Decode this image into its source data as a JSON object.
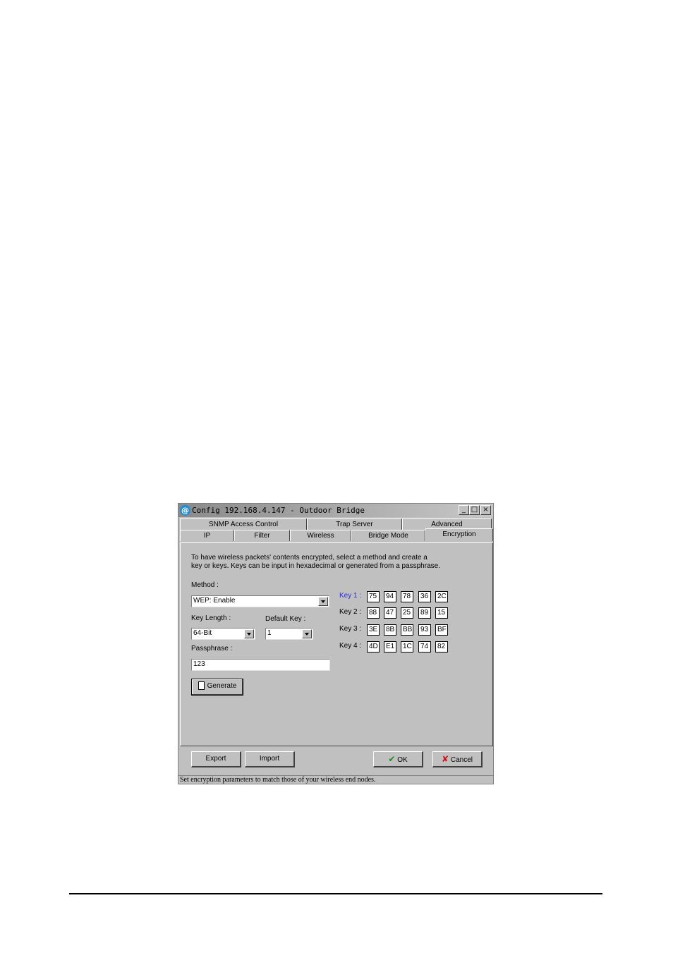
{
  "window": {
    "title": "Config 192.168.4.147 - Outdoor Bridge",
    "controls": [
      "_",
      "□",
      "×"
    ]
  },
  "tabs_row1": [
    "SNMP Access Control",
    "Trap Server",
    "Advanced"
  ],
  "tabs_row2": [
    "IP",
    "Filter",
    "Wireless",
    "Bridge Mode",
    "Encryption"
  ],
  "active_tab": "Encryption",
  "description": {
    "line1": "To have wireless packets' contents encrypted, select a method and create a",
    "line2": "key or keys. Keys can be input in hexadecimal or generated from a passphrase."
  },
  "method": {
    "label": "Method :",
    "value": "WEP: Enable"
  },
  "key_length": {
    "label": "Key Length :",
    "value": "64-Bit"
  },
  "default_key": {
    "label": "Default Key :",
    "value": "1"
  },
  "passphrase": {
    "label": "Passphrase :",
    "value": "123"
  },
  "generate_label": "Generate",
  "keys": [
    {
      "label": "Key 1 :",
      "values": [
        "75",
        "94",
        "78",
        "36",
        "2C"
      ]
    },
    {
      "label": "Key 2 :",
      "values": [
        "88",
        "47",
        "25",
        "89",
        "15"
      ]
    },
    {
      "label": "Key 3 :",
      "values": [
        "3E",
        "8B",
        "BB",
        "93",
        "BF"
      ]
    },
    {
      "label": "Key 4 :",
      "values": [
        "4D",
        "E1",
        "1C",
        "74",
        "82"
      ]
    }
  ],
  "buttons": {
    "export": "Export",
    "import": "Import",
    "ok": "OK",
    "cancel": "Cancel"
  },
  "status_text": "Set encryption parameters to match those of your wireless end nodes.",
  "colors": {
    "key1_label": "#2a2ad0",
    "ok_check": "#1a8a1a",
    "cancel_x": "#d01010"
  }
}
